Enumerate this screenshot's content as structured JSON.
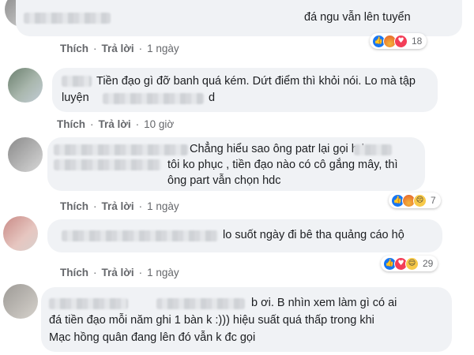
{
  "comments": [
    {
      "text_lines": [
        "đá ngu vẫn lên tuyển"
      ],
      "actions": {
        "like": "Thích",
        "reply": "Trả lời",
        "time": "1 ngày"
      },
      "reactions": {
        "icons": [
          "like-icon",
          "angry-icon",
          "love-icon"
        ],
        "count": "18"
      }
    },
    {
      "text_lines": [
        "Tiền đạo gì đỡ banh quá kém. Dứt điểm thì khỏi nói. Lo mà tập",
        "luyện",
        "d"
      ],
      "actions": {
        "like": "Thích",
        "reply": "Trả lời",
        "time": "10 giờ"
      }
    },
    {
      "text_lines": [
        "Chẳng hiểu sao ông patr lại gọi hdc,",
        "tôi ko phục , tiền đạo nào có cô gắng mây, thì",
        "ông part vẫn chọn hdc"
      ],
      "actions": {
        "like": "Thích",
        "reply": "Trả lời",
        "time": "1 ngày"
      },
      "reactions": {
        "icons": [
          "like-icon",
          "angry-icon",
          "sad-icon"
        ],
        "count": "7"
      }
    },
    {
      "text_lines": [
        "lo suốt ngày đi bê tha quảng cáo hộ"
      ],
      "actions": {
        "like": "Thích",
        "reply": "Trả lời",
        "time": "1 ngày"
      },
      "reactions": {
        "icons": [
          "like-icon",
          "love-icon",
          "haha-icon"
        ],
        "count": "29"
      }
    },
    {
      "text_lines": [
        "b ơi. B nhìn xem làm gì có ai",
        "đá tiền đạo mỗi năm ghi 1 bàn k :))) hiệu suất quá thấp trong khi",
        "Mạc hồng quân đang lên đó vẫn k đc gọi"
      ]
    }
  ],
  "colors": {
    "bubble": "#f0f2f5",
    "text": "#1c1e21",
    "meta": "#65676b",
    "like": "#1877f2",
    "love": "#f33e58"
  }
}
